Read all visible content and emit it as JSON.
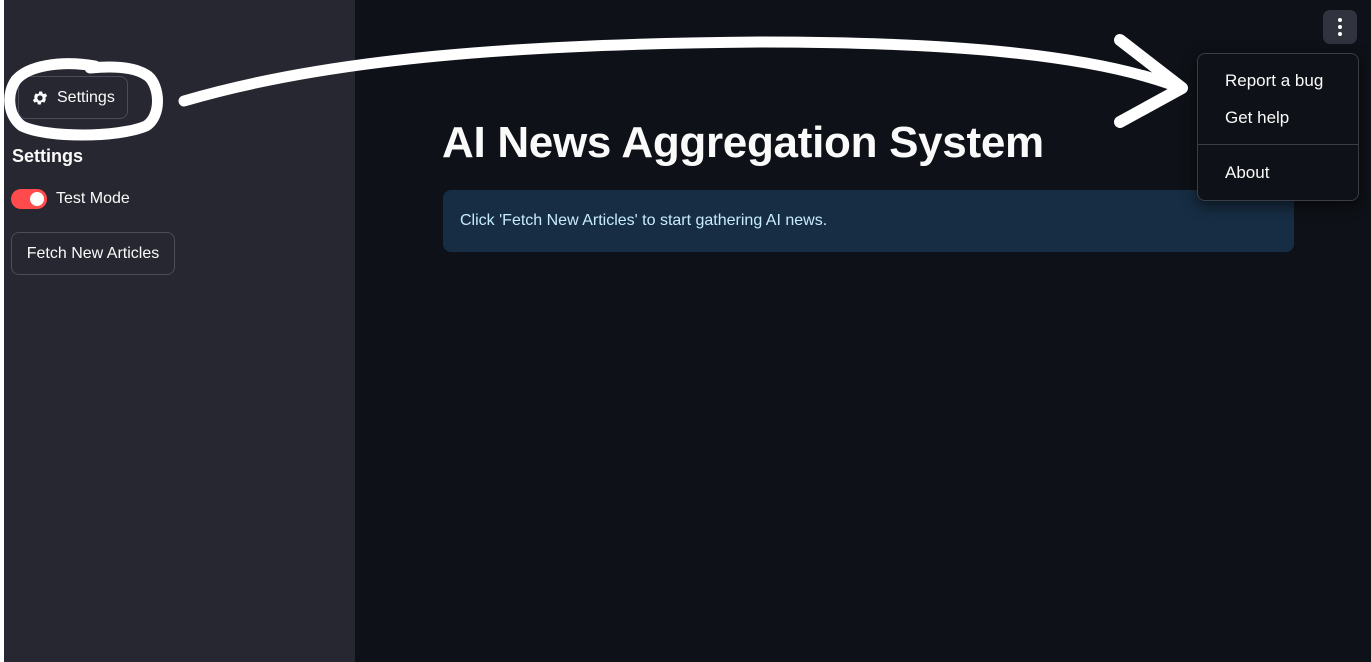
{
  "sidebar": {
    "settings_button_label": "Settings",
    "heading": "Settings",
    "test_mode": {
      "label": "Test Mode",
      "enabled": true
    },
    "fetch_button_label": "Fetch New Articles"
  },
  "main": {
    "title": "AI News Aggregation System",
    "info_message": "Click 'Fetch New Articles' to start gathering AI news."
  },
  "menu": {
    "items": [
      {
        "label": "Report a bug"
      },
      {
        "label": "Get help"
      },
      {
        "label": "About"
      }
    ]
  },
  "colors": {
    "sidebar_bg": "#262730",
    "main_bg": "#0e1117",
    "accent": "#ff4b4b",
    "info_bg": "#172d43",
    "info_text": "#c7ebff",
    "annotation": "#ffffff"
  },
  "icons": {
    "settings": "gear-icon",
    "menu": "vertical-dots-icon"
  }
}
